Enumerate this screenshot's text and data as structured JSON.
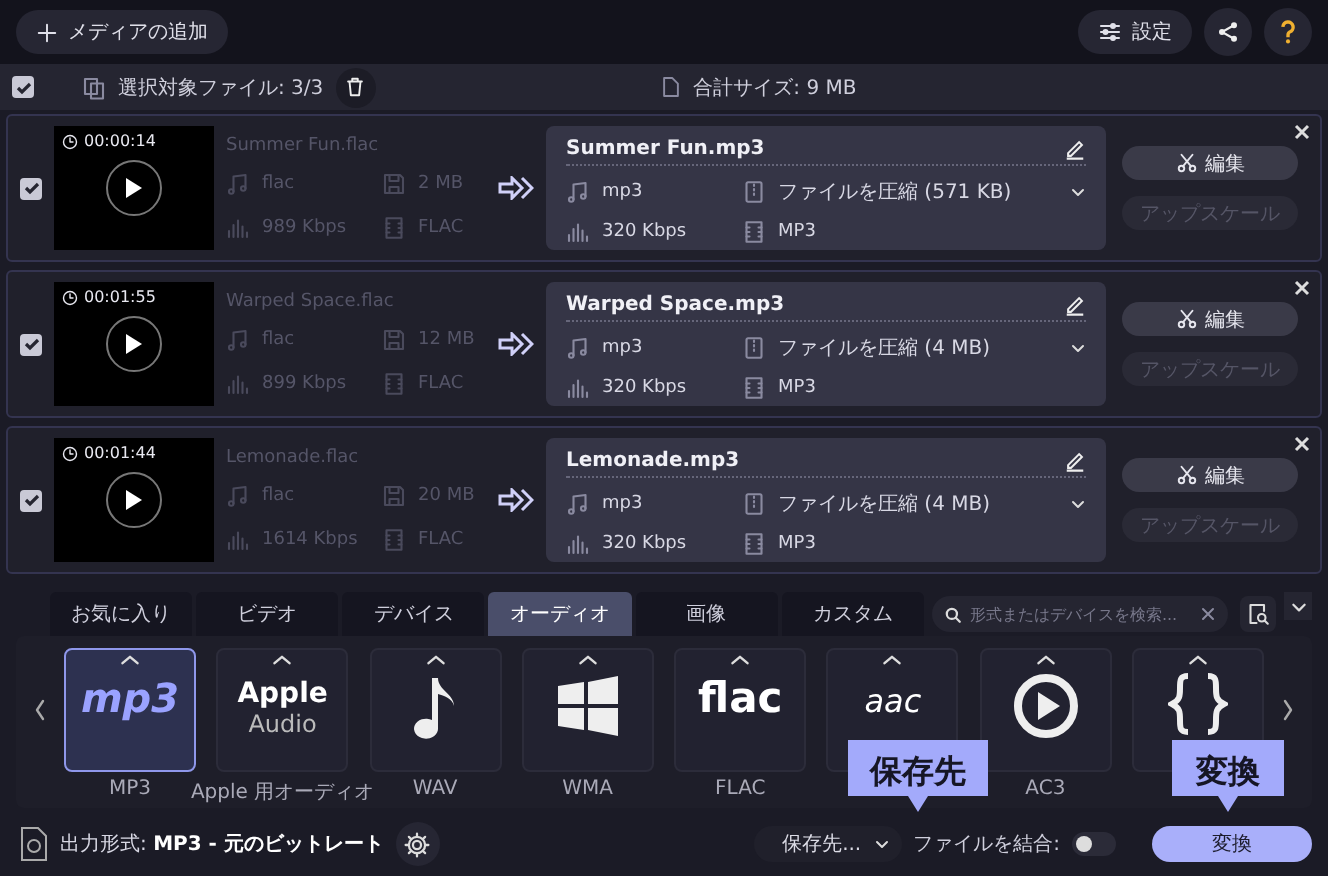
{
  "toolbar": {
    "add_media": "メディアの追加",
    "settings": "設定"
  },
  "selection_bar": {
    "all_checked": true,
    "selected_files": "選択対象ファイル: 3/3",
    "total_size": "合計サイズ: 9 MB"
  },
  "files": [
    {
      "checked": true,
      "duration": "00:00:14",
      "source_name": "Summer Fun.flac",
      "source_codec": "flac",
      "source_size": "2 MB",
      "source_bitrate": "989 Kbps",
      "source_format": "FLAC",
      "output_name": "Summer Fun.mp3",
      "output_codec": "mp3",
      "compress": "ファイルを圧縮 (571 KB)",
      "output_bitrate": "320 Kbps",
      "output_format": "MP3",
      "edit": "編集",
      "upscale": "アップスケール",
      "upscale_disabled": true
    },
    {
      "checked": true,
      "duration": "00:01:55",
      "source_name": "Warped Space.flac",
      "source_codec": "flac",
      "source_size": "12 MB",
      "source_bitrate": "899 Kbps",
      "source_format": "FLAC",
      "output_name": "Warped Space.mp3",
      "output_codec": "mp3",
      "compress": "ファイルを圧縮 (4 MB)",
      "output_bitrate": "320 Kbps",
      "output_format": "MP3",
      "edit": "編集",
      "upscale": "アップスケール",
      "upscale_disabled": true
    },
    {
      "checked": true,
      "duration": "00:01:44",
      "source_name": "Lemonade.flac",
      "source_codec": "flac",
      "source_size": "20 MB",
      "source_bitrate": "1614 Kbps",
      "source_format": "FLAC",
      "output_name": "Lemonade.mp3",
      "output_codec": "mp3",
      "compress": "ファイルを圧縮 (4 MB)",
      "output_bitrate": "320 Kbps",
      "output_format": "MP3",
      "edit": "編集",
      "upscale": "アップスケール",
      "upscale_disabled": true
    }
  ],
  "format_tabs": [
    {
      "label": "お気に入り",
      "selected": false
    },
    {
      "label": "ビデオ",
      "selected": false
    },
    {
      "label": "デバイス",
      "selected": false
    },
    {
      "label": "オーディオ",
      "selected": true
    },
    {
      "label": "画像",
      "selected": false
    },
    {
      "label": "カスタム",
      "selected": false
    }
  ],
  "format_search": {
    "placeholder": "形式またはデバイスを検索..."
  },
  "presets": [
    {
      "kind": "logo",
      "logo": "mp3",
      "label": "MP3",
      "selected": true
    },
    {
      "kind": "logo2",
      "logo": "Apple",
      "logo_sub": "Audio",
      "label": "Apple 用オーディオ",
      "selected": false
    },
    {
      "kind": "note",
      "label": "WAV",
      "selected": false
    },
    {
      "kind": "windows",
      "label": "WMA",
      "selected": false
    },
    {
      "kind": "logo",
      "logo": "flac",
      "label": "FLAC",
      "selected": false
    },
    {
      "kind": "logo",
      "logo": "aac",
      "selected": false
    },
    {
      "kind": "play",
      "label": "AC3",
      "selected": false
    },
    {
      "kind": "braces",
      "selected": false
    }
  ],
  "bottom_bar": {
    "output_format": "出力形式: **MP3 - 元のビットレート**",
    "save_to": "保存先...",
    "merge_label": "ファイルを結合:",
    "merge_on": false,
    "convert": "変換"
  },
  "callouts": [
    {
      "text": "保存先"
    },
    {
      "text": "変換"
    }
  ]
}
